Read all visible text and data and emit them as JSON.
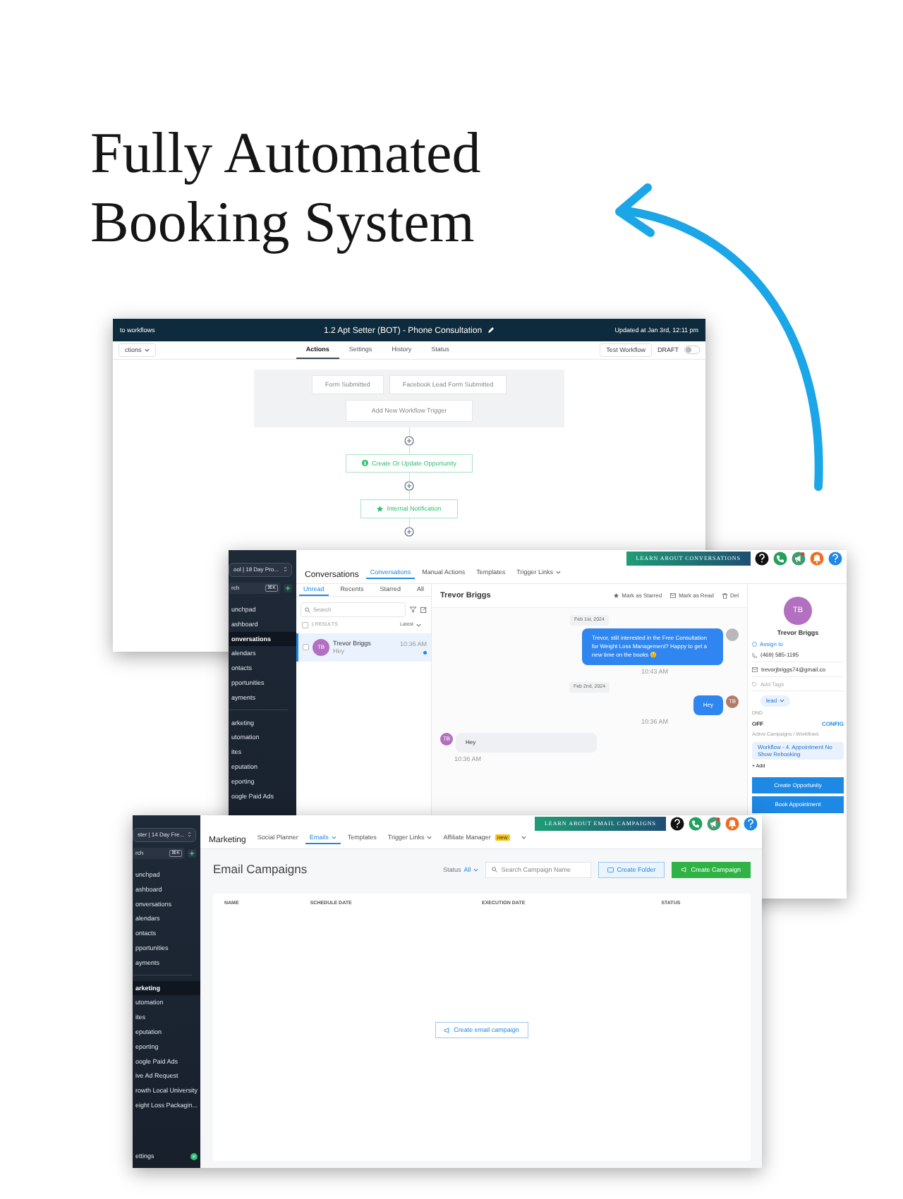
{
  "headline": "Fully Automated Booking System",
  "workflow_window": {
    "back_link": "to workflows",
    "title": "1.2 Apt Setter (BOT) - Phone Consultation",
    "updated": "Updated at Jan 3rd, 12:11 pm",
    "actions_menu": "ctions",
    "tabs": [
      {
        "label": "Actions",
        "selected": true
      },
      {
        "label": "Settings",
        "selected": false
      },
      {
        "label": "History",
        "selected": false
      },
      {
        "label": "Status",
        "selected": false
      }
    ],
    "test_button": "Test Workflow",
    "draft_label": "DRAFT",
    "publish_toggle": {
      "on": false
    },
    "triggers": [
      "Form Submitted",
      "Facebook Lead Form Submitted"
    ],
    "add_trigger": "Add New Workflow Trigger",
    "steps": [
      {
        "label": "Create Or Update Opportunity",
        "kind": "opportunity"
      },
      {
        "label": "Internal Notification",
        "kind": "notification"
      }
    ]
  },
  "conversations_window": {
    "sidebar": {
      "account": "ool | 18 Day Pro...",
      "search": "rch",
      "shortcut": "⌘K",
      "groups": [
        [
          {
            "label": "unchpad",
            "selected": false
          },
          {
            "label": "ashboard",
            "selected": false
          },
          {
            "label": "onversations",
            "selected": true
          },
          {
            "label": "alendars",
            "selected": false
          },
          {
            "label": "ontacts",
            "selected": false
          },
          {
            "label": "pportunities",
            "selected": false
          },
          {
            "label": "ayments",
            "selected": false
          }
        ],
        [
          {
            "label": "arketing",
            "selected": false
          },
          {
            "label": "utomation",
            "selected": false
          },
          {
            "label": "ites",
            "selected": false
          },
          {
            "label": "eputation",
            "selected": false
          },
          {
            "label": "eporting",
            "selected": false
          },
          {
            "label": "oogle Paid Ads",
            "selected": false
          }
        ]
      ]
    },
    "header": {
      "title": "Conversations",
      "tabs": [
        {
          "label": "Conversations",
          "selected": true,
          "dropdown": false
        },
        {
          "label": "Manual Actions",
          "selected": false,
          "dropdown": false
        },
        {
          "label": "Templates",
          "selected": false,
          "dropdown": false
        },
        {
          "label": "Trigger Links",
          "selected": false,
          "dropdown": true
        }
      ],
      "learn_button": "LEARN ABOUT CONVERSATIONS",
      "icons": [
        {
          "kind": "help",
          "color": "#111111"
        },
        {
          "kind": "phone",
          "color": "#22a05a"
        },
        {
          "kind": "megaphone",
          "color": "#3f9b6e"
        },
        {
          "kind": "bell",
          "color": "#f26b1d"
        },
        {
          "kind": "question",
          "color": "#1e88e5"
        }
      ]
    },
    "list": {
      "tabs": [
        {
          "label": "Unread",
          "selected": true
        },
        {
          "label": "Recents",
          "selected": false
        },
        {
          "label": "Starred",
          "selected": false
        },
        {
          "label": "All",
          "selected": false
        }
      ],
      "search_placeholder": "Search",
      "results": "1 RESULTS",
      "results_checked": false,
      "sort": "Latest",
      "items": [
        {
          "initials": "TB",
          "name": "Trevor Briggs",
          "preview": "Hey",
          "time": "10:36 AM",
          "checked": false,
          "unread": true,
          "selected": true
        }
      ]
    },
    "chat": {
      "contact": "Trevor Briggs",
      "actions": [
        "Mark as Starred",
        "Mark as Read",
        "Del"
      ],
      "messages": [
        {
          "kind": "date",
          "text": "Feb 1st, 2024"
        },
        {
          "kind": "outgoing",
          "text": "Trevor, still interested in the Free Consultation for Weight Loss Management? Happy to get a new time on the books 😊",
          "time": "10:43 AM",
          "color": "#b8b8b8"
        },
        {
          "kind": "date",
          "text": "Feb 2nd, 2024"
        },
        {
          "kind": "outgoing",
          "text": "Hey",
          "time": "10:36 AM",
          "initials": "TB",
          "color": "#b07a6a"
        },
        {
          "kind": "incoming",
          "text": "Hey",
          "time": "10:36 AM",
          "initials": "TB",
          "color": "#b36fc0"
        }
      ]
    },
    "contact_panel": {
      "initials": "TB",
      "name": "Trevor Briggs",
      "assign": "Assign to",
      "phone": "(469) 585-1195",
      "email": "trevorjbriggs74@gmail.co",
      "tags_placeholder": "Add Tags",
      "tag": "lead",
      "dnd_label": "DND",
      "dnd_value": "OFF",
      "dnd_link": "CONFIG",
      "campaigns_label": "Active Campaigns / Workflows",
      "campaign_chip": "Workflow - 4. Appointment No Show Rebooking",
      "add": "+ Add",
      "buttons": [
        "Create Opportunity",
        "Book Appointment"
      ]
    }
  },
  "email_window": {
    "sidebar": {
      "account": "ster | 14 Day Fre...",
      "search": "rch",
      "shortcut": "⌘K",
      "groups": [
        [
          {
            "label": "unchpad",
            "selected": false
          },
          {
            "label": "ashboard",
            "selected": false
          },
          {
            "label": "onversations",
            "selected": false
          },
          {
            "label": "alendars",
            "selected": false
          },
          {
            "label": "ontacts",
            "selected": false
          },
          {
            "label": "pportunities",
            "selected": false
          },
          {
            "label": "ayments",
            "selected": false
          }
        ],
        [
          {
            "label": "arketing",
            "selected": true
          },
          {
            "label": "utomation",
            "selected": false
          },
          {
            "label": "ites",
            "selected": false
          },
          {
            "label": "eputation",
            "selected": false
          },
          {
            "label": "eporting",
            "selected": false
          },
          {
            "label": "oogle Paid Ads",
            "selected": false
          },
          {
            "label": "ive Ad Request",
            "selected": false
          },
          {
            "label": "rowth Local University",
            "selected": false
          },
          {
            "label": "eight Loss Packagin...",
            "selected": false
          }
        ]
      ],
      "settings": "ettings"
    },
    "header": {
      "title": "Marketing",
      "tabs": [
        {
          "label": "Social Planner",
          "selected": false,
          "dropdown": false
        },
        {
          "label": "Emails",
          "selected": true,
          "dropdown": true
        },
        {
          "label": "Templates",
          "selected": false,
          "dropdown": false
        },
        {
          "label": "Trigger Links",
          "selected": false,
          "dropdown": true
        },
        {
          "label": "Affiliate Manager",
          "selected": false,
          "dropdown": false,
          "badge": "new"
        }
      ],
      "more_menu": true,
      "learn_button": "LEARN ABOUT EMAIL CAMPAIGNS",
      "icons": [
        {
          "kind": "help",
          "color": "#111111"
        },
        {
          "kind": "phone",
          "color": "#22a05a"
        },
        {
          "kind": "megaphone",
          "color": "#3f9b6e"
        },
        {
          "kind": "bell",
          "color": "#f26b1d"
        },
        {
          "kind": "question",
          "color": "#1e88e5"
        }
      ]
    },
    "page_title": "Email Campaigns",
    "status_label": "Status",
    "status_value": "All",
    "search_placeholder": "Search Campaign Name",
    "create_folder": "Create Folder",
    "create_campaign": "Create Campaign",
    "columns": [
      "NAME",
      "SCHEDULE DATE",
      "EXECUTION DATE",
      "STATUS"
    ],
    "empty_button": "Create email campaign"
  }
}
